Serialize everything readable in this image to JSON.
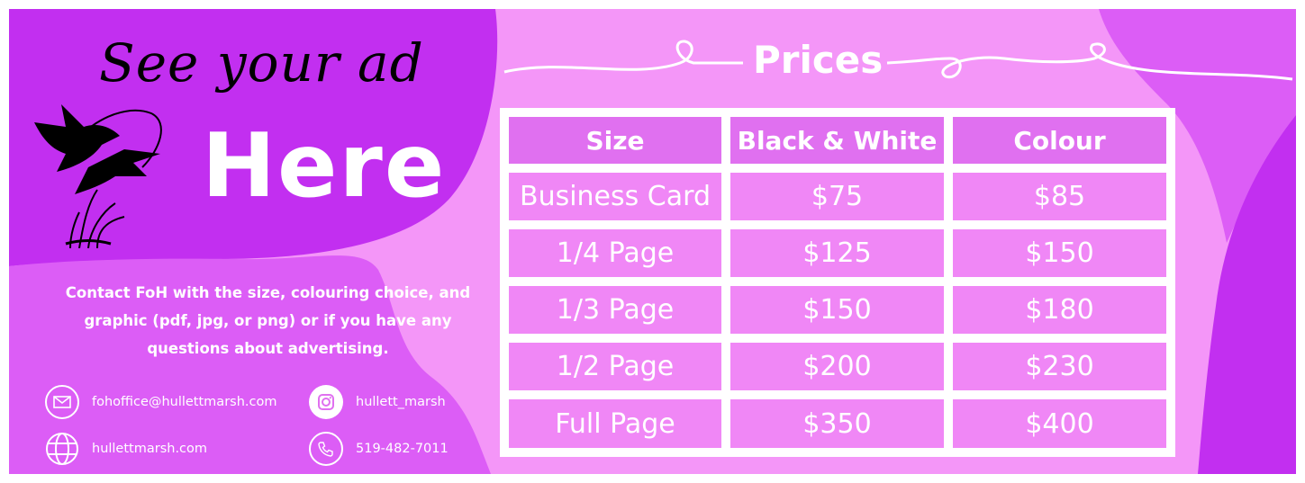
{
  "colors": {
    "blob_dark": "#c22ff0",
    "blob_mid": "#dc5df6",
    "background": "#f496f8",
    "table_border": "#ffffff",
    "text": "#ffffff"
  },
  "headline": {
    "script": "See your ad",
    "big": "Here"
  },
  "contact": {
    "message": "Contact FoH with the size, colouring choice, and graphic (pdf, jpg, or png) or if you have any questions about advertising.",
    "email": "fohoffice@hullettmarsh.com",
    "instagram": "hullett_marsh",
    "website": "hullettmarsh.com",
    "phone": "519-482-7011",
    "icons": [
      "email-icon",
      "instagram-icon",
      "globe-icon",
      "phone-icon"
    ]
  },
  "prices": {
    "title": "Prices",
    "headers": [
      "Size",
      "Black & White",
      "Colour"
    ],
    "rows": [
      [
        "Business Card",
        "$75",
        "$85"
      ],
      [
        "1/4 Page",
        "$125",
        "$150"
      ],
      [
        "1/3 Page",
        "$150",
        "$180"
      ],
      [
        "1/2 Page",
        "$200",
        "$230"
      ],
      [
        "Full Page",
        "$350",
        "$400"
      ]
    ]
  }
}
